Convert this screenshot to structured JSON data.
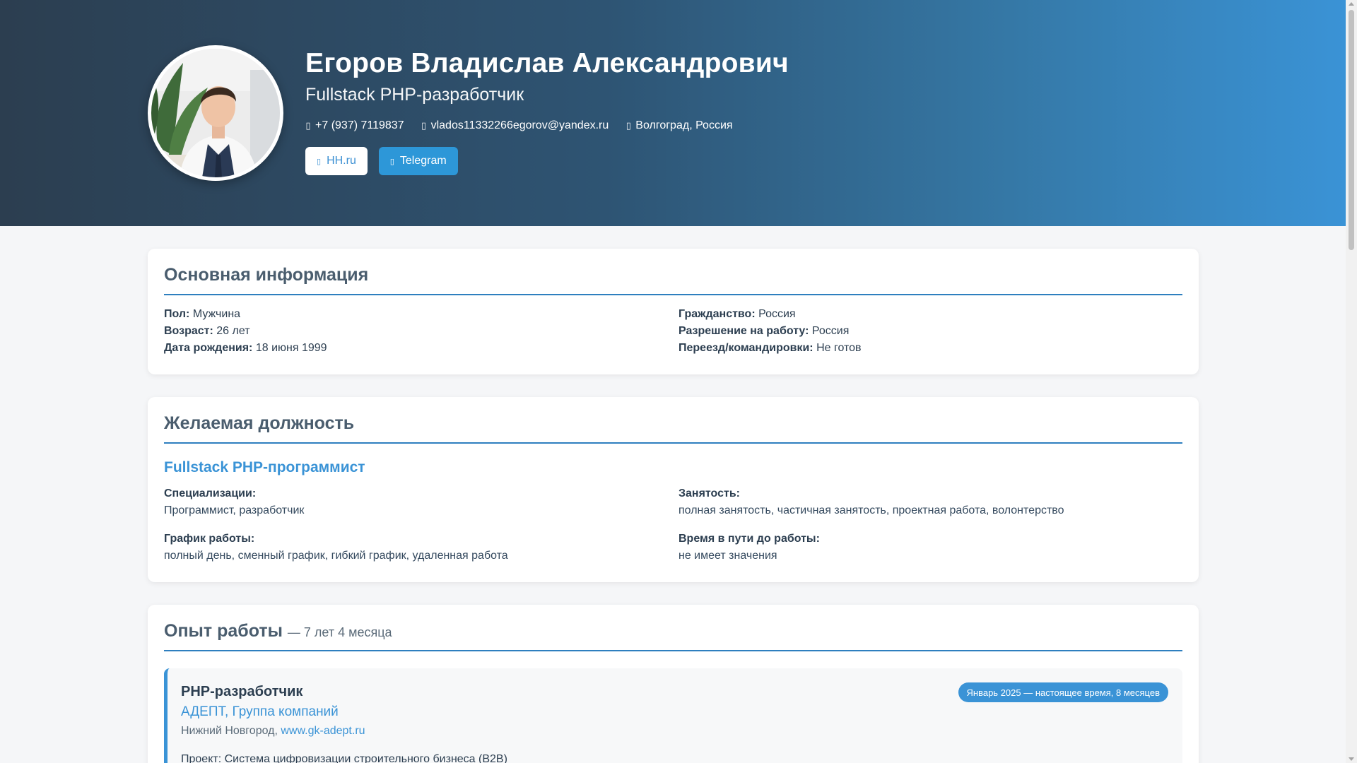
{
  "profile": {
    "name": "Егоров Владислав Александрович",
    "title": "Fullstack PHP-разработчик",
    "phone": "+7 (937) 7119837",
    "email": "vlados11332266egorov@yandex.ru",
    "location": "Волгоград, Россия",
    "phone_icon": "phone-icon",
    "email_icon": "envelope-icon",
    "location_icon": "map-marker-icon"
  },
  "buttons": {
    "hh_label": "HH.ru",
    "telegram_label": "Telegram"
  },
  "basic": {
    "heading": "Основная информация",
    "gender_label": "Пол:",
    "gender": "Мужчина",
    "age_label": "Возраст:",
    "age": "26 лет",
    "birth_label": "Дата рождения:",
    "birth": "18 июня 1999",
    "citizenship_label": "Гражданство:",
    "citizenship": "Россия",
    "permit_label": "Разрешение на работу:",
    "permit": "Россия",
    "relocation_label": "Переезд/командировки:",
    "relocation": "Не готов"
  },
  "desired": {
    "heading": "Желаемая должность",
    "position": "Fullstack PHP-программист",
    "spec_label": "Специализации:",
    "spec": "Программист, разработчик",
    "employment_label": "Занятость:",
    "employment": "полная занятость, частичная занятость, проектная работа, волонтерство",
    "schedule_label": "График работы:",
    "schedule": "полный день, сменный график, гибкий график, удаленная работа",
    "commute_label": "Время в пути до работы:",
    "commute": "не имеет значения"
  },
  "experience": {
    "heading": "Опыт работы",
    "total": "— 7 лет 4 месяца",
    "jobs": [
      {
        "title": "PHP-разработчик",
        "company": "АДЕПТ, Группа компаний",
        "city": "Нижний Новгород,",
        "site": "www.gk-adept.ru",
        "period": "Январь 2025 — настоящее время, 8 месяцев",
        "project": "Проект: Система цифровизации строительного бизнеса (B2B)"
      }
    ]
  },
  "colors": {
    "accent": "#3a93d6",
    "header_dark": "#2c3e50",
    "header_light": "#3a93d6"
  }
}
